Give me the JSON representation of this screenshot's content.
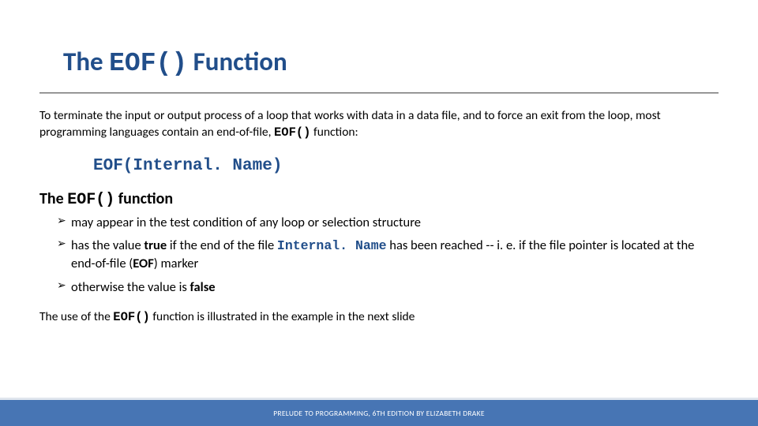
{
  "title": {
    "pre": "The ",
    "code": "EOF()",
    "post": " Function"
  },
  "intro": {
    "text1": "To terminate the input or output process of a loop that works with data in a data file, and to force an exit from the loop, most programming languages contain an end-of-file, ",
    "code": "EOF()",
    "text2": " function:"
  },
  "syntax_line": "EOF(Internal. Name)",
  "subheading": {
    "pre": "The ",
    "code": "EOF()",
    "post": " function"
  },
  "bullets": [
    {
      "text": "may appear in the test condition of any loop or selection structure"
    },
    {
      "pre": "has the value ",
      "b1": "true",
      "mid1": " if the end of the file ",
      "code": "Internal. Name",
      "mid2": " has been reached -- i. e. if the file pointer is located at the end-of-file (",
      "b2": "EOF",
      "post": ") marker"
    },
    {
      "pre": "otherwise the value is ",
      "b1": "false"
    }
  ],
  "closing": {
    "pre": "The use of the ",
    "code": "EOF()",
    "post": " function is illustrated in the example in the next slide"
  },
  "footer": "PRELUDE TO PROGRAMMING, 6TH EDITION BY ELIZABETH DRAKE"
}
